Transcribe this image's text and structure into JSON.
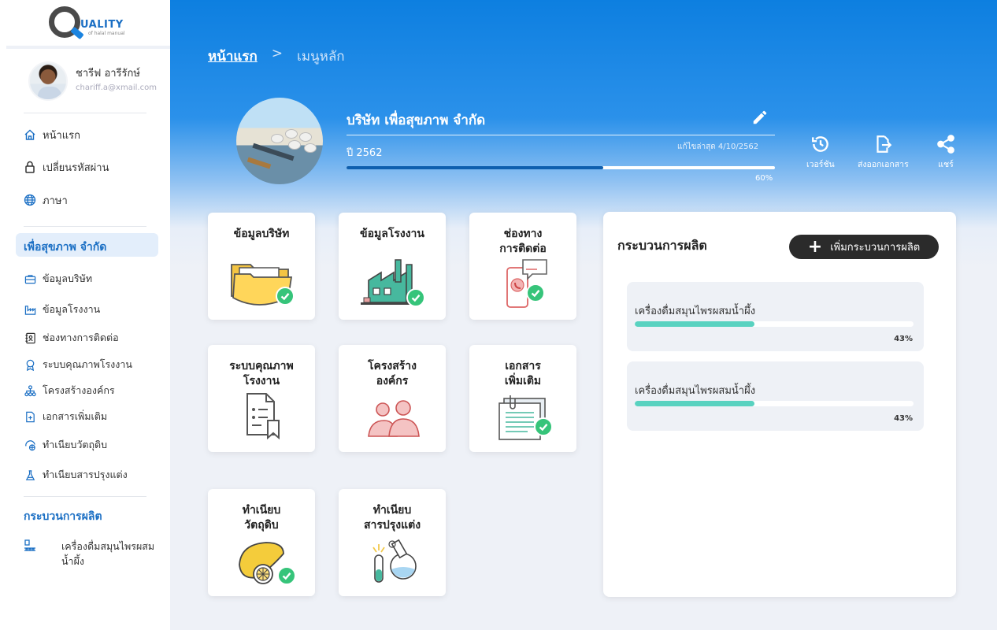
{
  "brand": {
    "name": "UALITY",
    "tagline": "of halal manual"
  },
  "user": {
    "name": "ชารีฟ  อารีรักษ์",
    "email": "chariff.a@xmail.com"
  },
  "nav": {
    "home": "หน้าแรก",
    "change_password": "เปลี่ยนรหัสผ่าน",
    "language": "ภาษา"
  },
  "company_menu": {
    "title": "เพื่อสุขภาพ  จำกัด",
    "items": [
      {
        "label": "ข้อมูลบริษัท",
        "icon": "briefcase-icon"
      },
      {
        "label": "ข้อมูลโรงงาน",
        "icon": "factory-icon"
      },
      {
        "label": "ช่องทางการติดต่อ",
        "icon": "contact-book-icon"
      },
      {
        "label": "ระบบคุณภาพโรงงาน",
        "icon": "award-icon"
      },
      {
        "label": "โครงสร้างองค์กร",
        "icon": "org-chart-icon"
      },
      {
        "label": "เอกสารเพิ่มเติม",
        "icon": "document-icon"
      },
      {
        "label": "ทำเนียบวัตถุดิบ",
        "icon": "ingredient-icon"
      },
      {
        "label": "ทำเนียบสารปรุงแต่ง",
        "icon": "flask-icon"
      }
    ]
  },
  "process_menu": {
    "title": "กระบวนการผลิต",
    "items": [
      {
        "label": "เครื่องดื่มสมุนไพรผสม\nน้ำผึ้ง"
      }
    ]
  },
  "breadcrumb": {
    "home": "หน้าแรก",
    "separator": ">",
    "current": "เมนูหลัก"
  },
  "company": {
    "name": "บริษัท  เพื่อสุขภาพ  จำกัด",
    "year": "ปี  2562",
    "updated": "แก้ไขล่าสุด  4/10/2562",
    "progress": 0.6,
    "progress_label": "60%"
  },
  "actions": [
    {
      "label": "เวอร์ชัน",
      "icon": "history-icon"
    },
    {
      "label": "ส่งออกเอกสาร",
      "icon": "export-document-icon"
    },
    {
      "label": "แชร์",
      "icon": "share-icon"
    }
  ],
  "tiles": [
    {
      "label": "ข้อมูลบริษัท",
      "done": true
    },
    {
      "label": "ข้อมูลโรงงาน",
      "done": true
    },
    {
      "label": "ช่องทาง\nการติดต่อ",
      "done": true
    },
    {
      "label": "ระบบคุณภาพ\nโรงงาน",
      "done": false
    },
    {
      "label": "โครงสร้าง\nองค์กร",
      "done": false
    },
    {
      "label": "เอกสาร\nเพิ่มเติม",
      "done": true
    },
    {
      "label": "ทำเนียบ\nวัตถุดิบ",
      "done": true
    },
    {
      "label": "ทำเนียบ\nสารปรุงแต่ง",
      "done": false
    }
  ],
  "process_panel": {
    "title": "กระบวนการผลิต",
    "add_label": "เพิ่มกระบวนการผลิต",
    "items": [
      {
        "name": "เครื่องดื่มสมุนไพรผสมน้ำผึ้ง",
        "progress": 0.43,
        "label": "43%"
      },
      {
        "name": "เครื่องดื่มสมุนไพรผสมน้ำผึ้ง",
        "progress": 0.43,
        "label": "43%"
      }
    ]
  },
  "colors": {
    "primary": "#1b6fc4",
    "header_blue": "#0d7fe0",
    "check_green": "#36c47a",
    "progress_teal": "#59d2c0"
  }
}
